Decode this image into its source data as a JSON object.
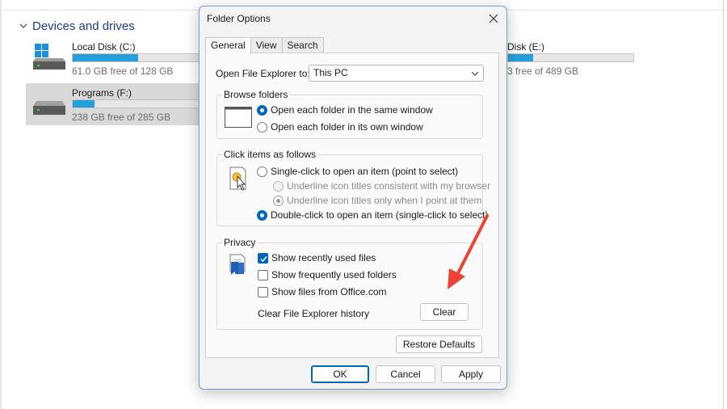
{
  "explorer": {
    "section_title": "Devices and drives",
    "drives": [
      {
        "name": "Local Disk (C:)",
        "free": "61.0 GB free of 128 GB",
        "used_percent": 52,
        "icon": "windows-drive-icon"
      },
      {
        "name": "Programs (F:)",
        "free": "238 GB free of 285 GB",
        "used_percent": 17,
        "icon": "hard-drive-icon"
      },
      {
        "name": "Disk (E:)",
        "free": "3 free of 489 GB",
        "used_percent": 20,
        "icon": "hard-drive-icon"
      }
    ]
  },
  "dialog": {
    "title": "Folder Options",
    "tabs": [
      "General",
      "View",
      "Search"
    ],
    "open_label": "Open File Explorer to:",
    "open_value": "This PC",
    "browse": {
      "title": "Browse folders",
      "options": [
        "Open each folder in the same window",
        "Open each folder in its own window"
      ]
    },
    "click": {
      "title": "Click items as follows",
      "options": [
        "Single-click to open an item (point to select)",
        "Underline icon titles consistent with my browser",
        "Underline icon titles only when I point at them",
        "Double-click to open an item (single-click to select)"
      ]
    },
    "privacy": {
      "title": "Privacy",
      "options": [
        "Show recently used files",
        "Show frequently used folders",
        "Show files from Office.com"
      ],
      "clear_label": "Clear File Explorer history",
      "clear_button": "Clear"
    },
    "restore_button": "Restore Defaults",
    "ok_button": "OK",
    "cancel_button": "Cancel",
    "apply_button": "Apply"
  },
  "colors": {
    "accent": "#0067c0",
    "drive_bar": "#26a0da",
    "annotation_arrow": "#ef4136"
  }
}
